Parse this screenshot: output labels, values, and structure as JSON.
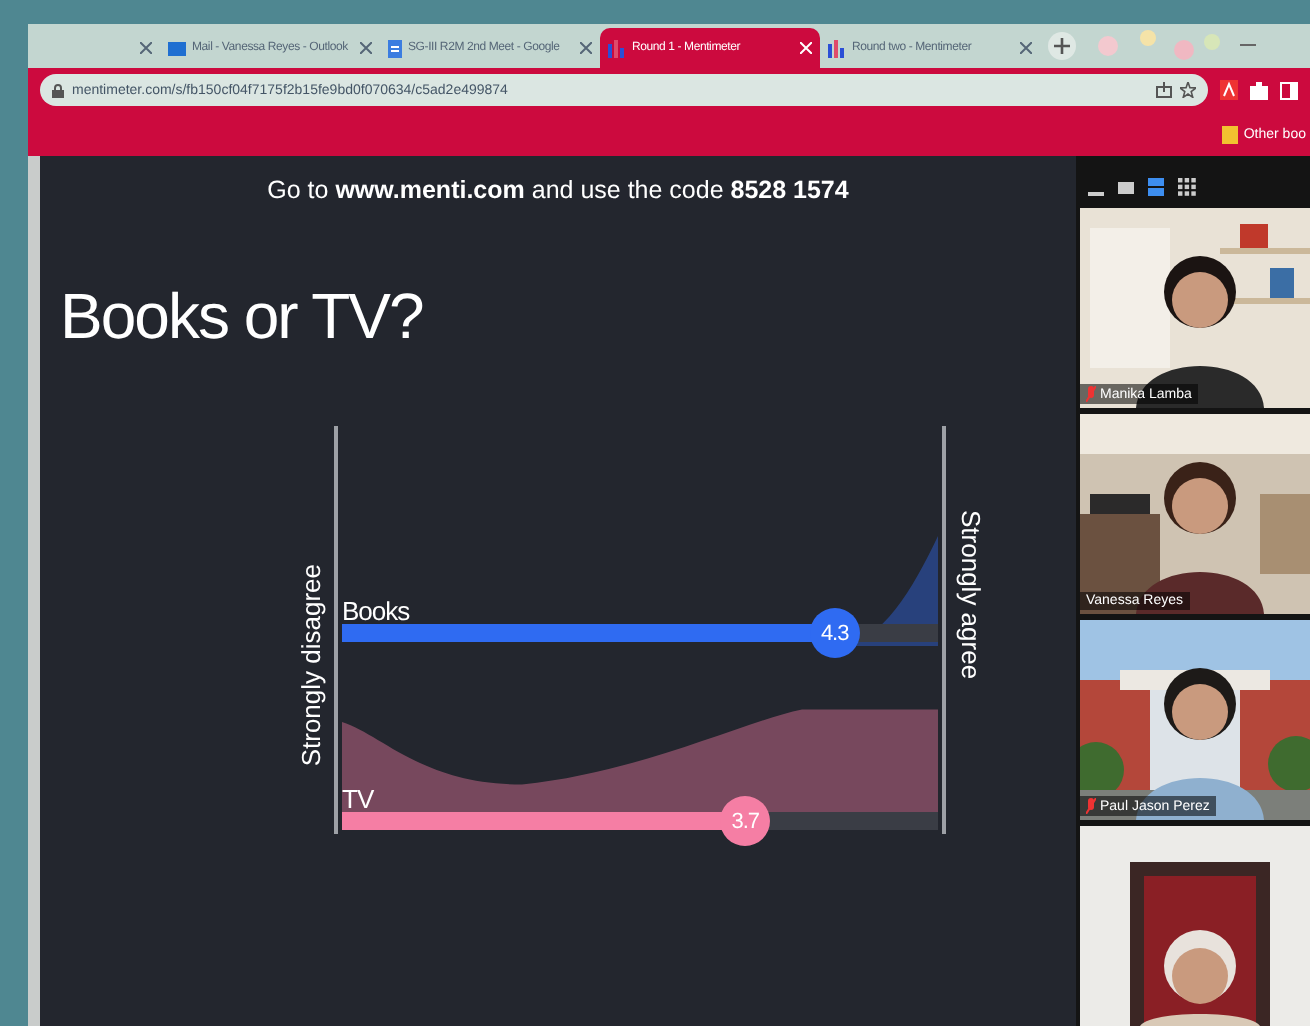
{
  "tabs": [
    {
      "selected": false,
      "kind": "cut"
    },
    {
      "label": "Mail - Vanessa Reyes - Outlook",
      "selected": false,
      "kind": "mail"
    },
    {
      "label": "SG-III R2M 2nd Meet - Google",
      "selected": false,
      "kind": "doc"
    },
    {
      "label": "Round 1 - Mentimeter",
      "selected": true,
      "kind": "menti"
    },
    {
      "label": "Round two - Mentimeter",
      "selected": false,
      "kind": "menti"
    }
  ],
  "address_bar": {
    "url": "mentimeter.com/s/fb150cf04f7175f2b15fe9bd0f070634/c5ad2e499874"
  },
  "bookmarks_bar": {
    "other_bookmarks": "Other boo"
  },
  "slide": {
    "instruction": "Go to **www.menti.com** and use the code **8528 1574**",
    "title": "Books or TV?",
    "scale": {
      "left_label": "Strongly disagree",
      "right_label": "Strongly agree",
      "statements": [
        {
          "label": "Books",
          "value": "4.3",
          "level": 0.825,
          "color": "#2f6bf2"
        },
        {
          "label": "TV",
          "value": "3.7",
          "level": 0.675,
          "color": "#f57ea4"
        }
      ]
    }
  },
  "participants": [
    {
      "name": "Manika Lamba",
      "muted": true,
      "kind": "picture"
    },
    {
      "name": "Vanessa Reyes",
      "muted": false,
      "kind": "picture"
    },
    {
      "name": "Paul Jason Perez",
      "muted": true,
      "kind": "picture"
    },
    {
      "kind": "picture"
    }
  ]
}
